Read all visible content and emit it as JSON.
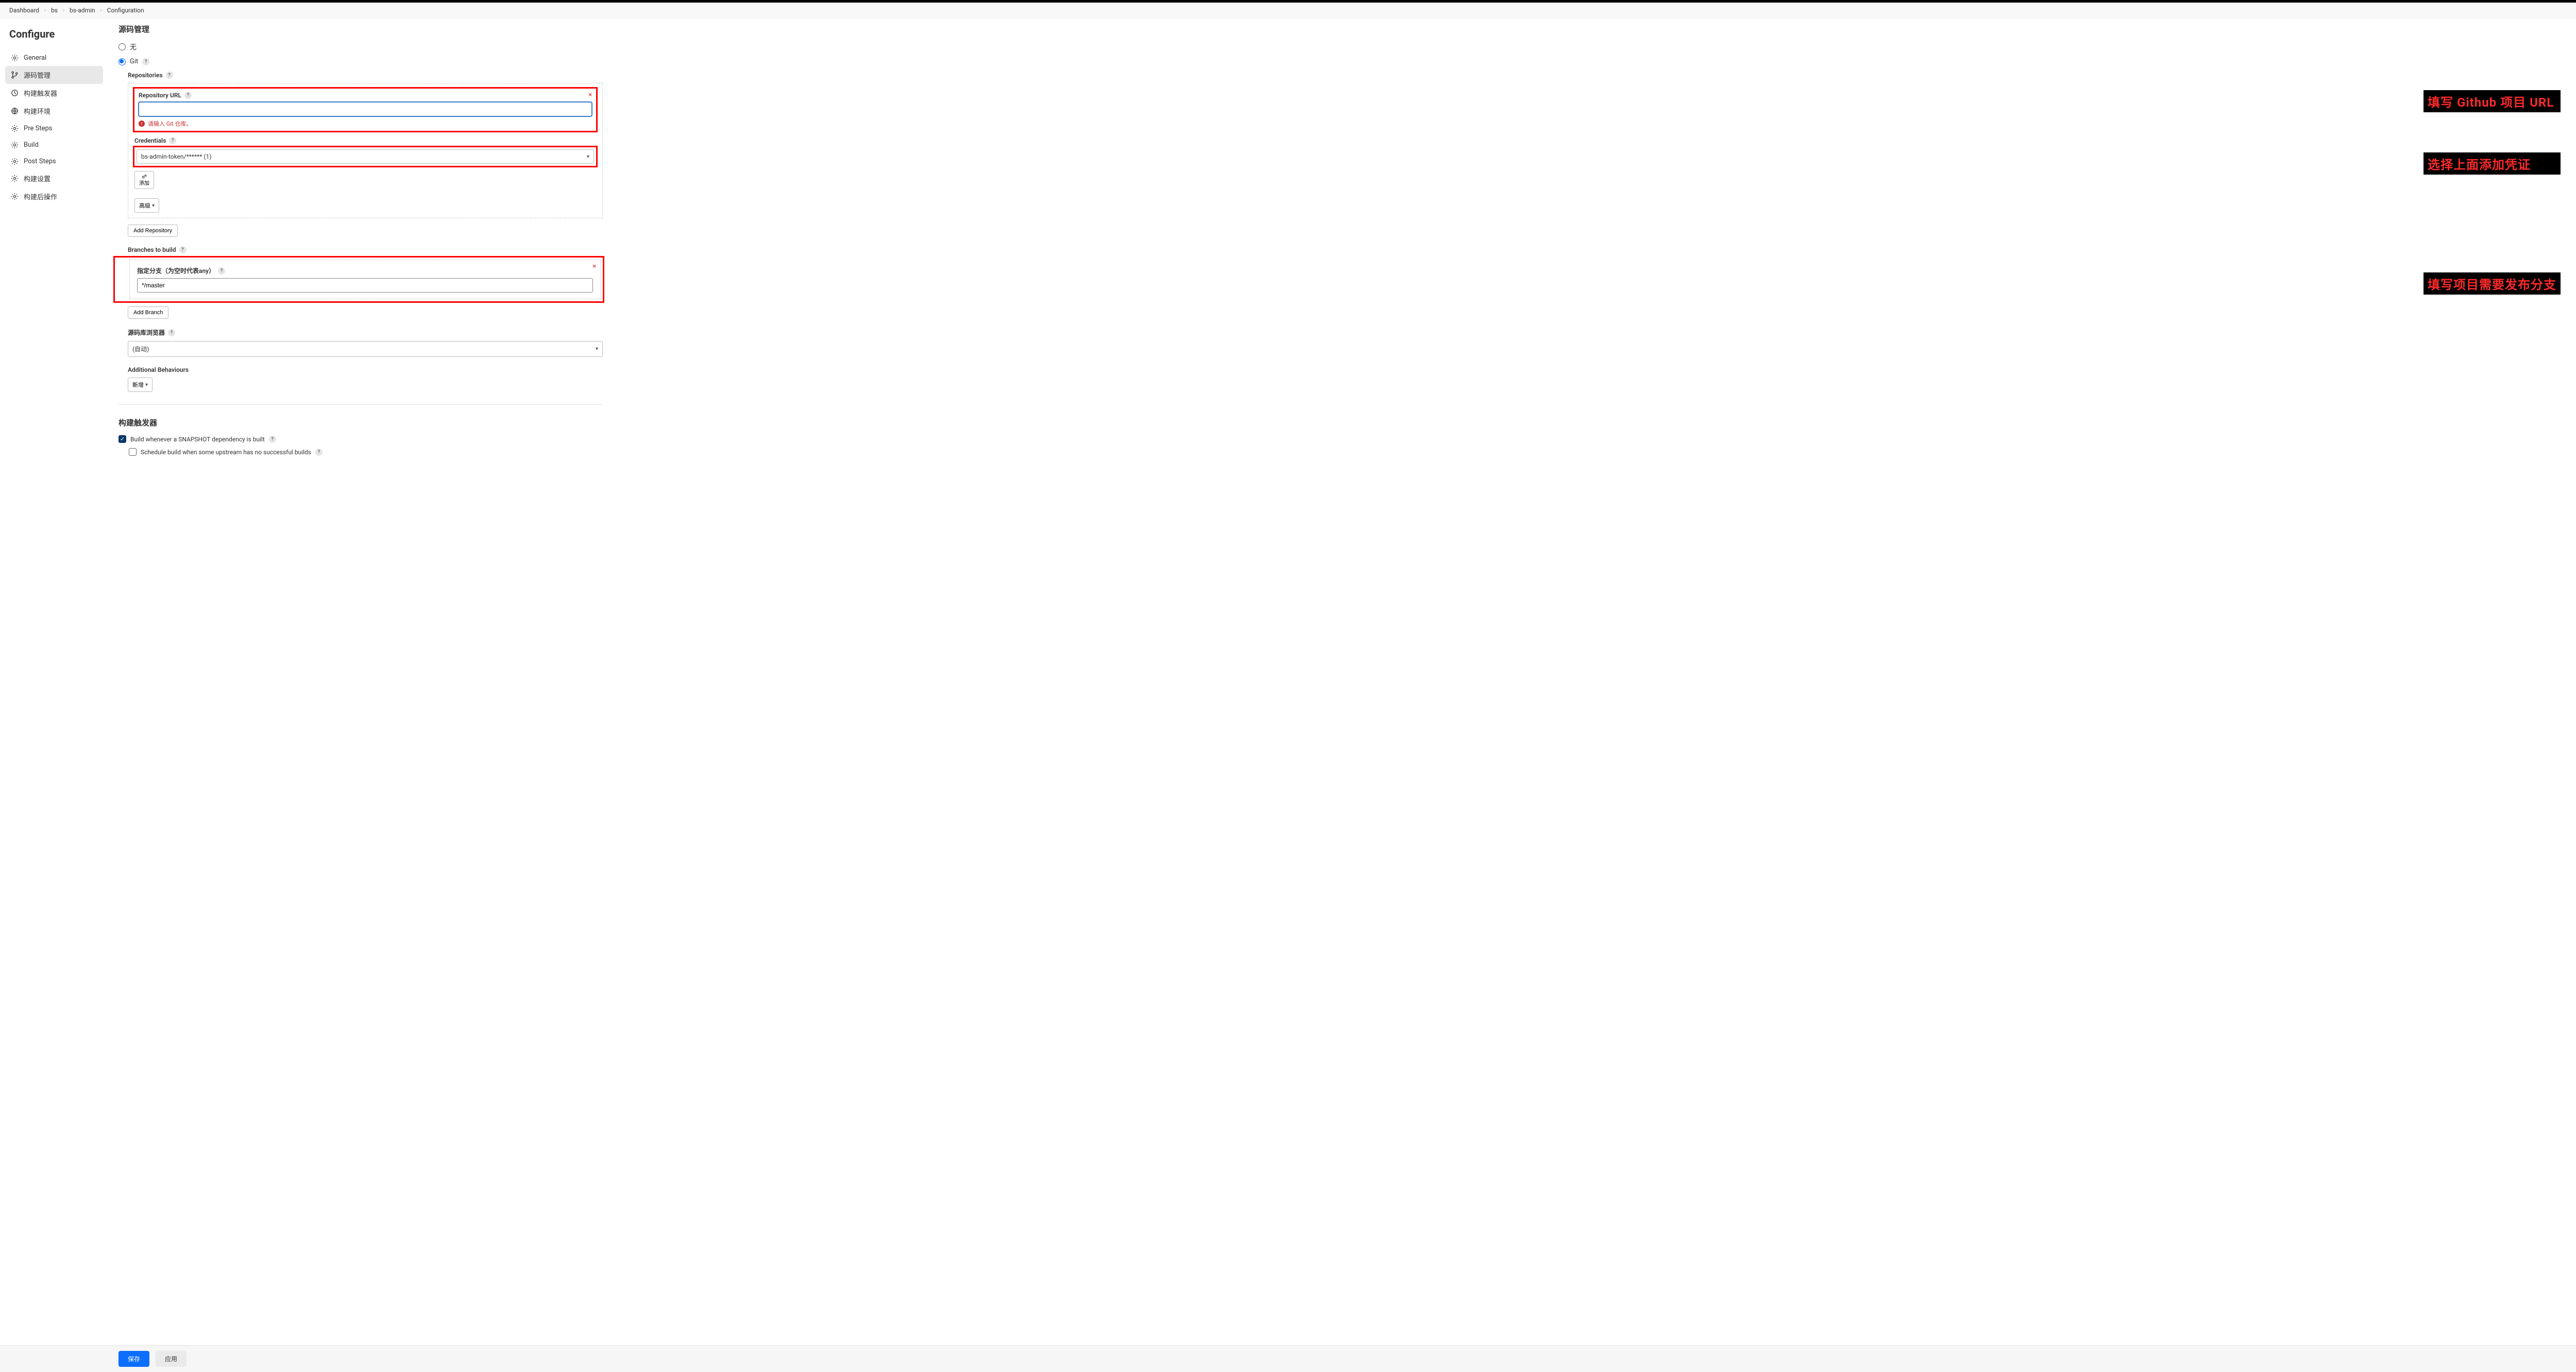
{
  "breadcrumb": {
    "items": [
      "Dashboard",
      "bs",
      "bs-admin",
      "Configuration"
    ]
  },
  "sidebar": {
    "title": "Configure",
    "items": [
      {
        "label": "General",
        "icon": "gear"
      },
      {
        "label": "源码管理",
        "icon": "branch",
        "active": true
      },
      {
        "label": "构建触发器",
        "icon": "clock"
      },
      {
        "label": "构建环境",
        "icon": "globe"
      },
      {
        "label": "Pre Steps",
        "icon": "gear"
      },
      {
        "label": "Build",
        "icon": "gear"
      },
      {
        "label": "Post Steps",
        "icon": "gear"
      },
      {
        "label": "构建设置",
        "icon": "gear"
      },
      {
        "label": "构建后操作",
        "icon": "gear"
      }
    ]
  },
  "main": {
    "scm": {
      "title": "源码管理",
      "opt_none": "无",
      "opt_git": "Git",
      "repositories_label": "Repositories",
      "repo": {
        "url_label": "Repository URL",
        "url_value": "",
        "error_text": "请输入 Git 仓库。",
        "credentials_label": "Credentials",
        "credentials_value": "bs-admin-token/****** (1)",
        "add_btn": "添加",
        "advanced_btn": "高级"
      },
      "add_repository_btn": "Add Repository",
      "branches_label": "Branches to build",
      "branch": {
        "label": "指定分支（为空时代表any）",
        "value": "*/master"
      },
      "add_branch_btn": "Add Branch",
      "browser_label": "源码库浏览器",
      "browser_value": "(自动)",
      "additional_label": "Additional Behaviours",
      "additional_btn": "新增"
    },
    "triggers": {
      "title": "构建触发器",
      "snapshot_label": "Build whenever a SNAPSHOT dependency is built",
      "schedule_label": "Schedule build when some upstream has no successful builds"
    }
  },
  "annotations": {
    "a1": "填写 Github 项目 URL",
    "a2": "选择上面添加凭证",
    "a3": "填写项目需要发布分支"
  },
  "bottom": {
    "save": "保存",
    "apply": "应用"
  }
}
